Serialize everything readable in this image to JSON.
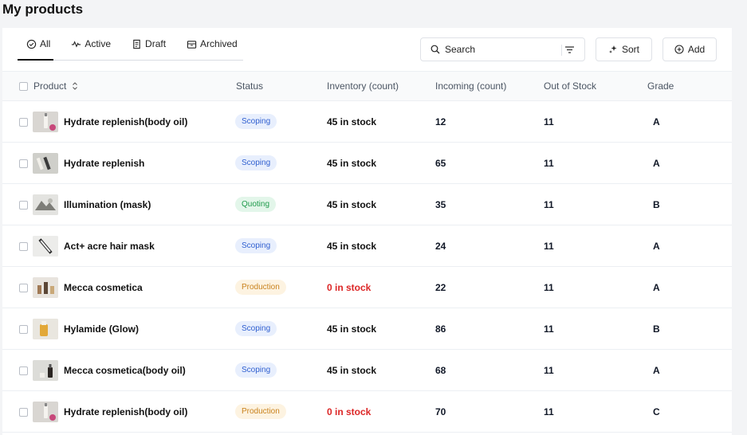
{
  "page": {
    "title": "My products"
  },
  "tabs": [
    {
      "label": "All",
      "icon": "check-circle-icon",
      "active": true
    },
    {
      "label": "Active",
      "icon": "activity-icon",
      "active": false
    },
    {
      "label": "Draft",
      "icon": "document-icon",
      "active": false
    },
    {
      "label": "Archived",
      "icon": "archive-icon",
      "active": false
    }
  ],
  "search": {
    "placeholder": "Search"
  },
  "toolbar": {
    "sort_label": "Sort",
    "add_label": "Add"
  },
  "table": {
    "headers": {
      "product": "Product",
      "status": "Status",
      "inventory": "Inventory (count)",
      "incoming": "Incoming (count)",
      "out_of_stock": "Out of Stock",
      "grade": "Grade"
    },
    "rows": [
      {
        "name": "Hydrate replenish(body oil)",
        "status": "Scoping",
        "status_type": "scoping",
        "inventory": "45 in stock",
        "incoming": "12",
        "out_of_stock": "11",
        "grade": "A"
      },
      {
        "name": "Hydrate replenish",
        "status": "Scoping",
        "status_type": "scoping",
        "inventory": "45 in stock",
        "incoming": "65",
        "out_of_stock": "11",
        "grade": "A"
      },
      {
        "name": "Illumination (mask)",
        "status": "Quoting",
        "status_type": "quoting",
        "inventory": "45 in stock",
        "incoming": "35",
        "out_of_stock": "11",
        "grade": "B"
      },
      {
        "name": "Act+ acre hair mask",
        "status": "Scoping",
        "status_type": "scoping",
        "inventory": "45 in stock",
        "incoming": "24",
        "out_of_stock": "11",
        "grade": "A"
      },
      {
        "name": "Mecca cosmetica",
        "status": "Production",
        "status_type": "production",
        "inventory": "0 in stock",
        "incoming": "22",
        "out_of_stock": "11",
        "grade": "A"
      },
      {
        "name": "Hylamide (Glow)",
        "status": "Scoping",
        "status_type": "scoping",
        "inventory": "45 in stock",
        "incoming": "86",
        "out_of_stock": "11",
        "grade": "B"
      },
      {
        "name": "Mecca cosmetica(body oil)",
        "status": "Scoping",
        "status_type": "scoping",
        "inventory": "45 in stock",
        "incoming": "68",
        "out_of_stock": "11",
        "grade": "A"
      },
      {
        "name": "Hydrate replenish(body oil)",
        "status": "Production",
        "status_type": "production",
        "inventory": "0 in stock",
        "incoming": "70",
        "out_of_stock": "11",
        "grade": "C"
      }
    ]
  }
}
